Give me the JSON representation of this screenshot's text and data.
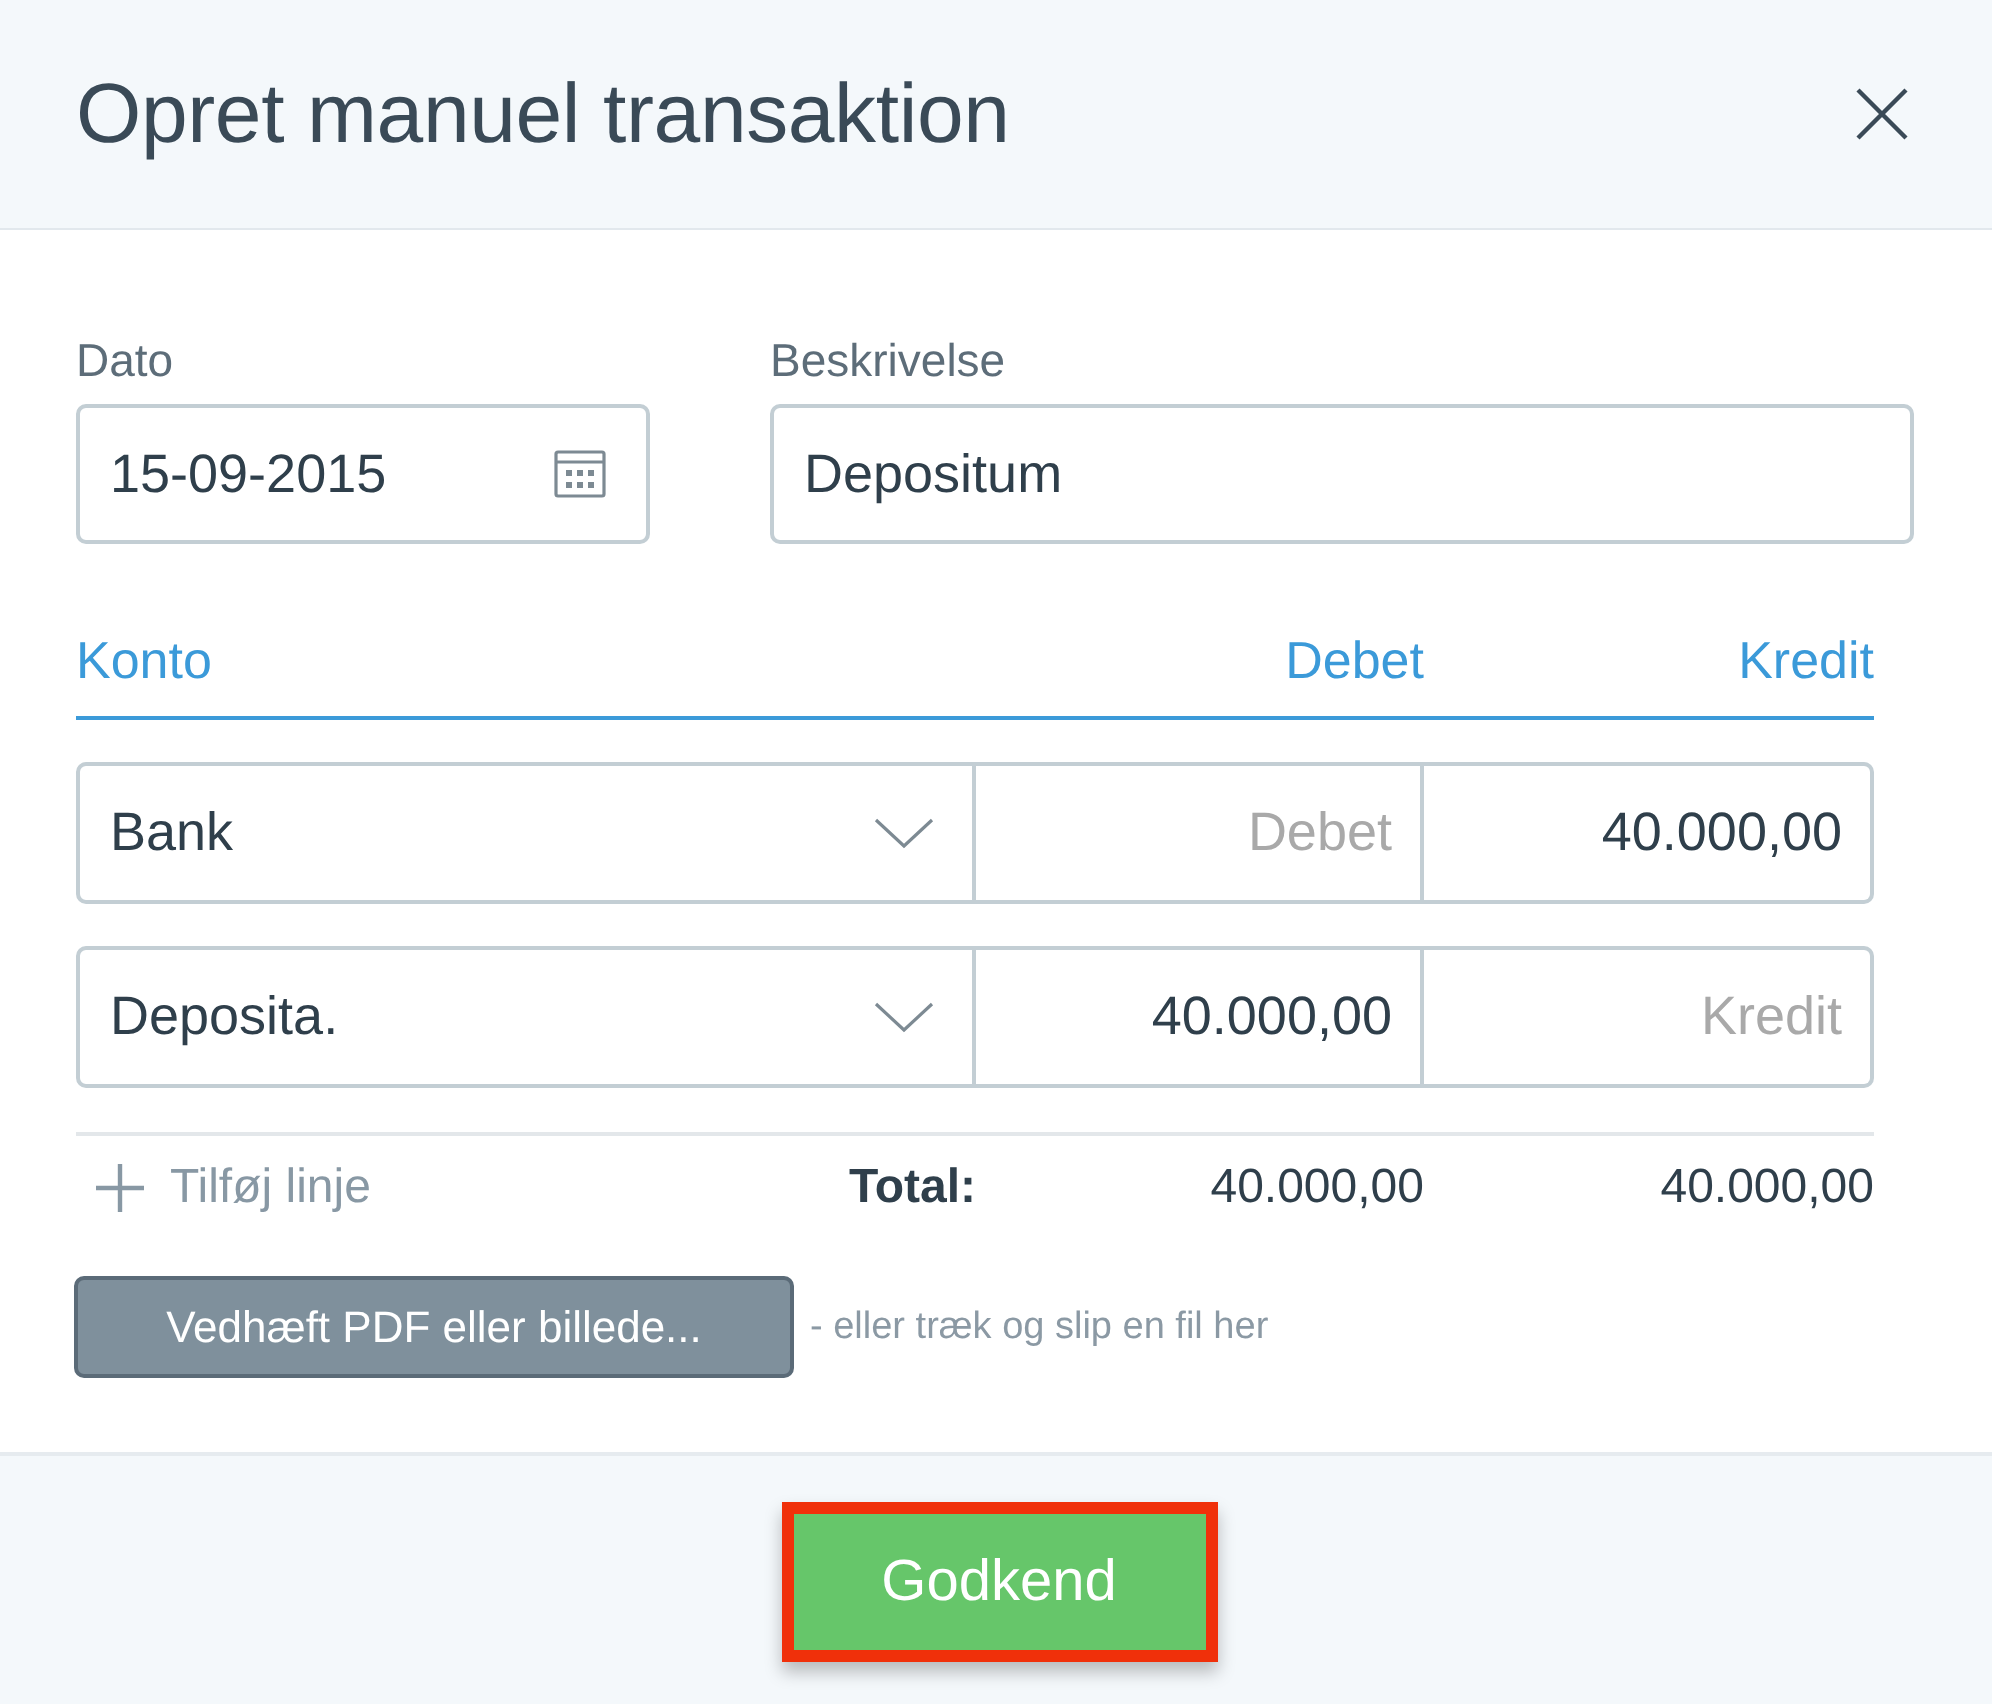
{
  "dialog": {
    "title": "Opret manuel transaktion"
  },
  "fields": [
    {
      "kind": "date",
      "label": "Dato",
      "value": "15-09-2015"
    },
    {
      "kind": "text",
      "label": "Beskrivelse",
      "value": "Depositum"
    }
  ],
  "table": {
    "columns": [
      "Konto",
      "Debet",
      "Kredit"
    ],
    "rows": [
      {
        "account": "Bank",
        "debit": {
          "placeholder": "Debet"
        },
        "credit": {
          "value": "40.000,00"
        }
      },
      {
        "account": "Deposita.",
        "debit": {
          "value": "40.000,00"
        },
        "credit": {
          "placeholder": "Kredit"
        }
      }
    ],
    "add_line": "Tilføj linje",
    "totals": {
      "label": "Total:",
      "debit": "40.000,00",
      "credit": "40.000,00"
    }
  },
  "attachment": {
    "button": "Vedhæft PDF eller billede...",
    "hint": "- eller træk og slip en fil her"
  },
  "footer": {
    "button": {
      "label": "Godkend",
      "highlighted": true
    }
  }
}
